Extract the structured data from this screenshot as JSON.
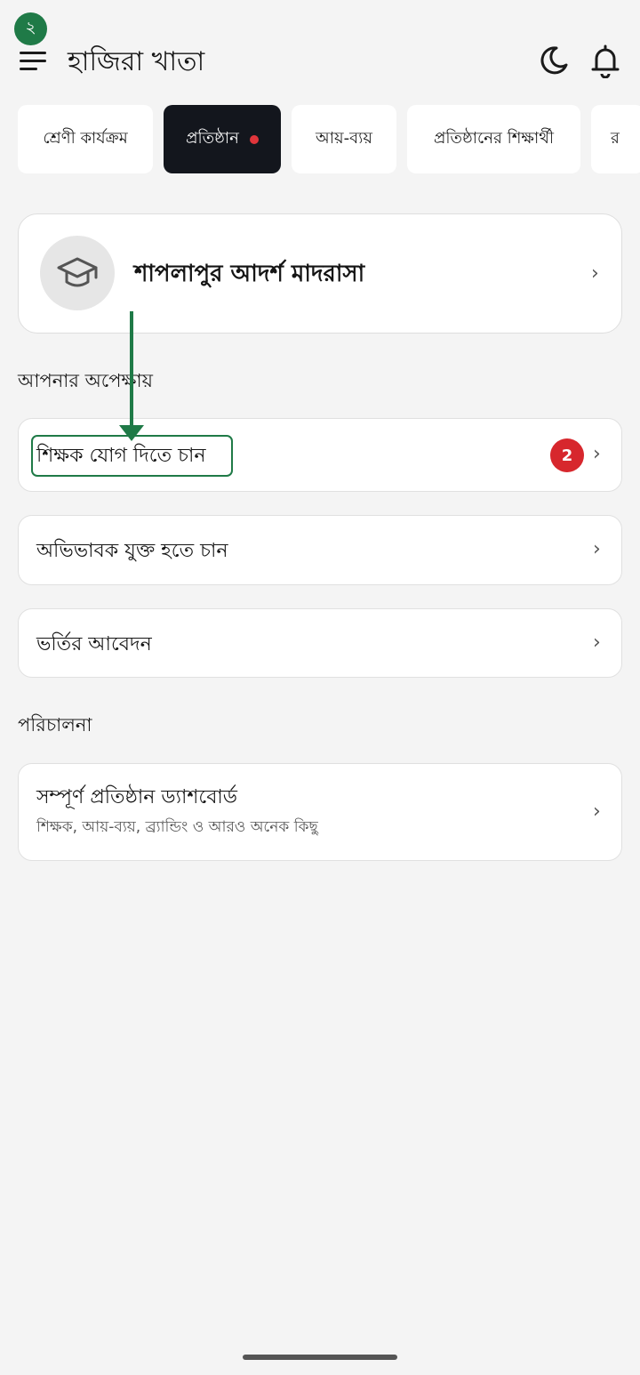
{
  "step_badge": "২",
  "header": {
    "title": "হাজিরা খাতা",
    "menu_icon": "hamburger-menu-icon",
    "theme_icon": "moon-icon",
    "notification_icon": "bell-icon"
  },
  "tabs": [
    {
      "label": "শ্রেণী কার্যক্রম",
      "active": false
    },
    {
      "label": "প্রতিষ্ঠান",
      "active": true,
      "has_dot": true
    },
    {
      "label": "আয়-ব্যয়",
      "active": false
    },
    {
      "label": "প্রতিষ্ঠানের শিক্ষার্থী",
      "active": false
    },
    {
      "label": "র",
      "active": false
    }
  ],
  "institution": {
    "name": "শাপলাপুর আদর্শ মাদরাসা",
    "icon": "graduation-cap-icon"
  },
  "sections": {
    "pending_title": "আপনার অপেক্ষায়",
    "management_title": "পরিচালনা"
  },
  "pending_items": [
    {
      "label": "শিক্ষক যোগ দিতে চান",
      "count": "2"
    },
    {
      "label": "অভিভাবক যুক্ত হতে চান"
    },
    {
      "label": "ভর্তির আবেদন"
    }
  ],
  "dashboard": {
    "title": "সম্পূর্ণ প্রতিষ্ঠান ড্যাশবোর্ড",
    "subtitle": "শিক্ষক, আয়-ব্যয়, ব্র্যান্ডিং ও আরও অনেক কিছু"
  },
  "chevron": "›",
  "colors": {
    "accent_green": "#1f7a47",
    "alert_red": "#d7272d",
    "active_tab": "#13161d",
    "background": "#f4f4f4"
  }
}
